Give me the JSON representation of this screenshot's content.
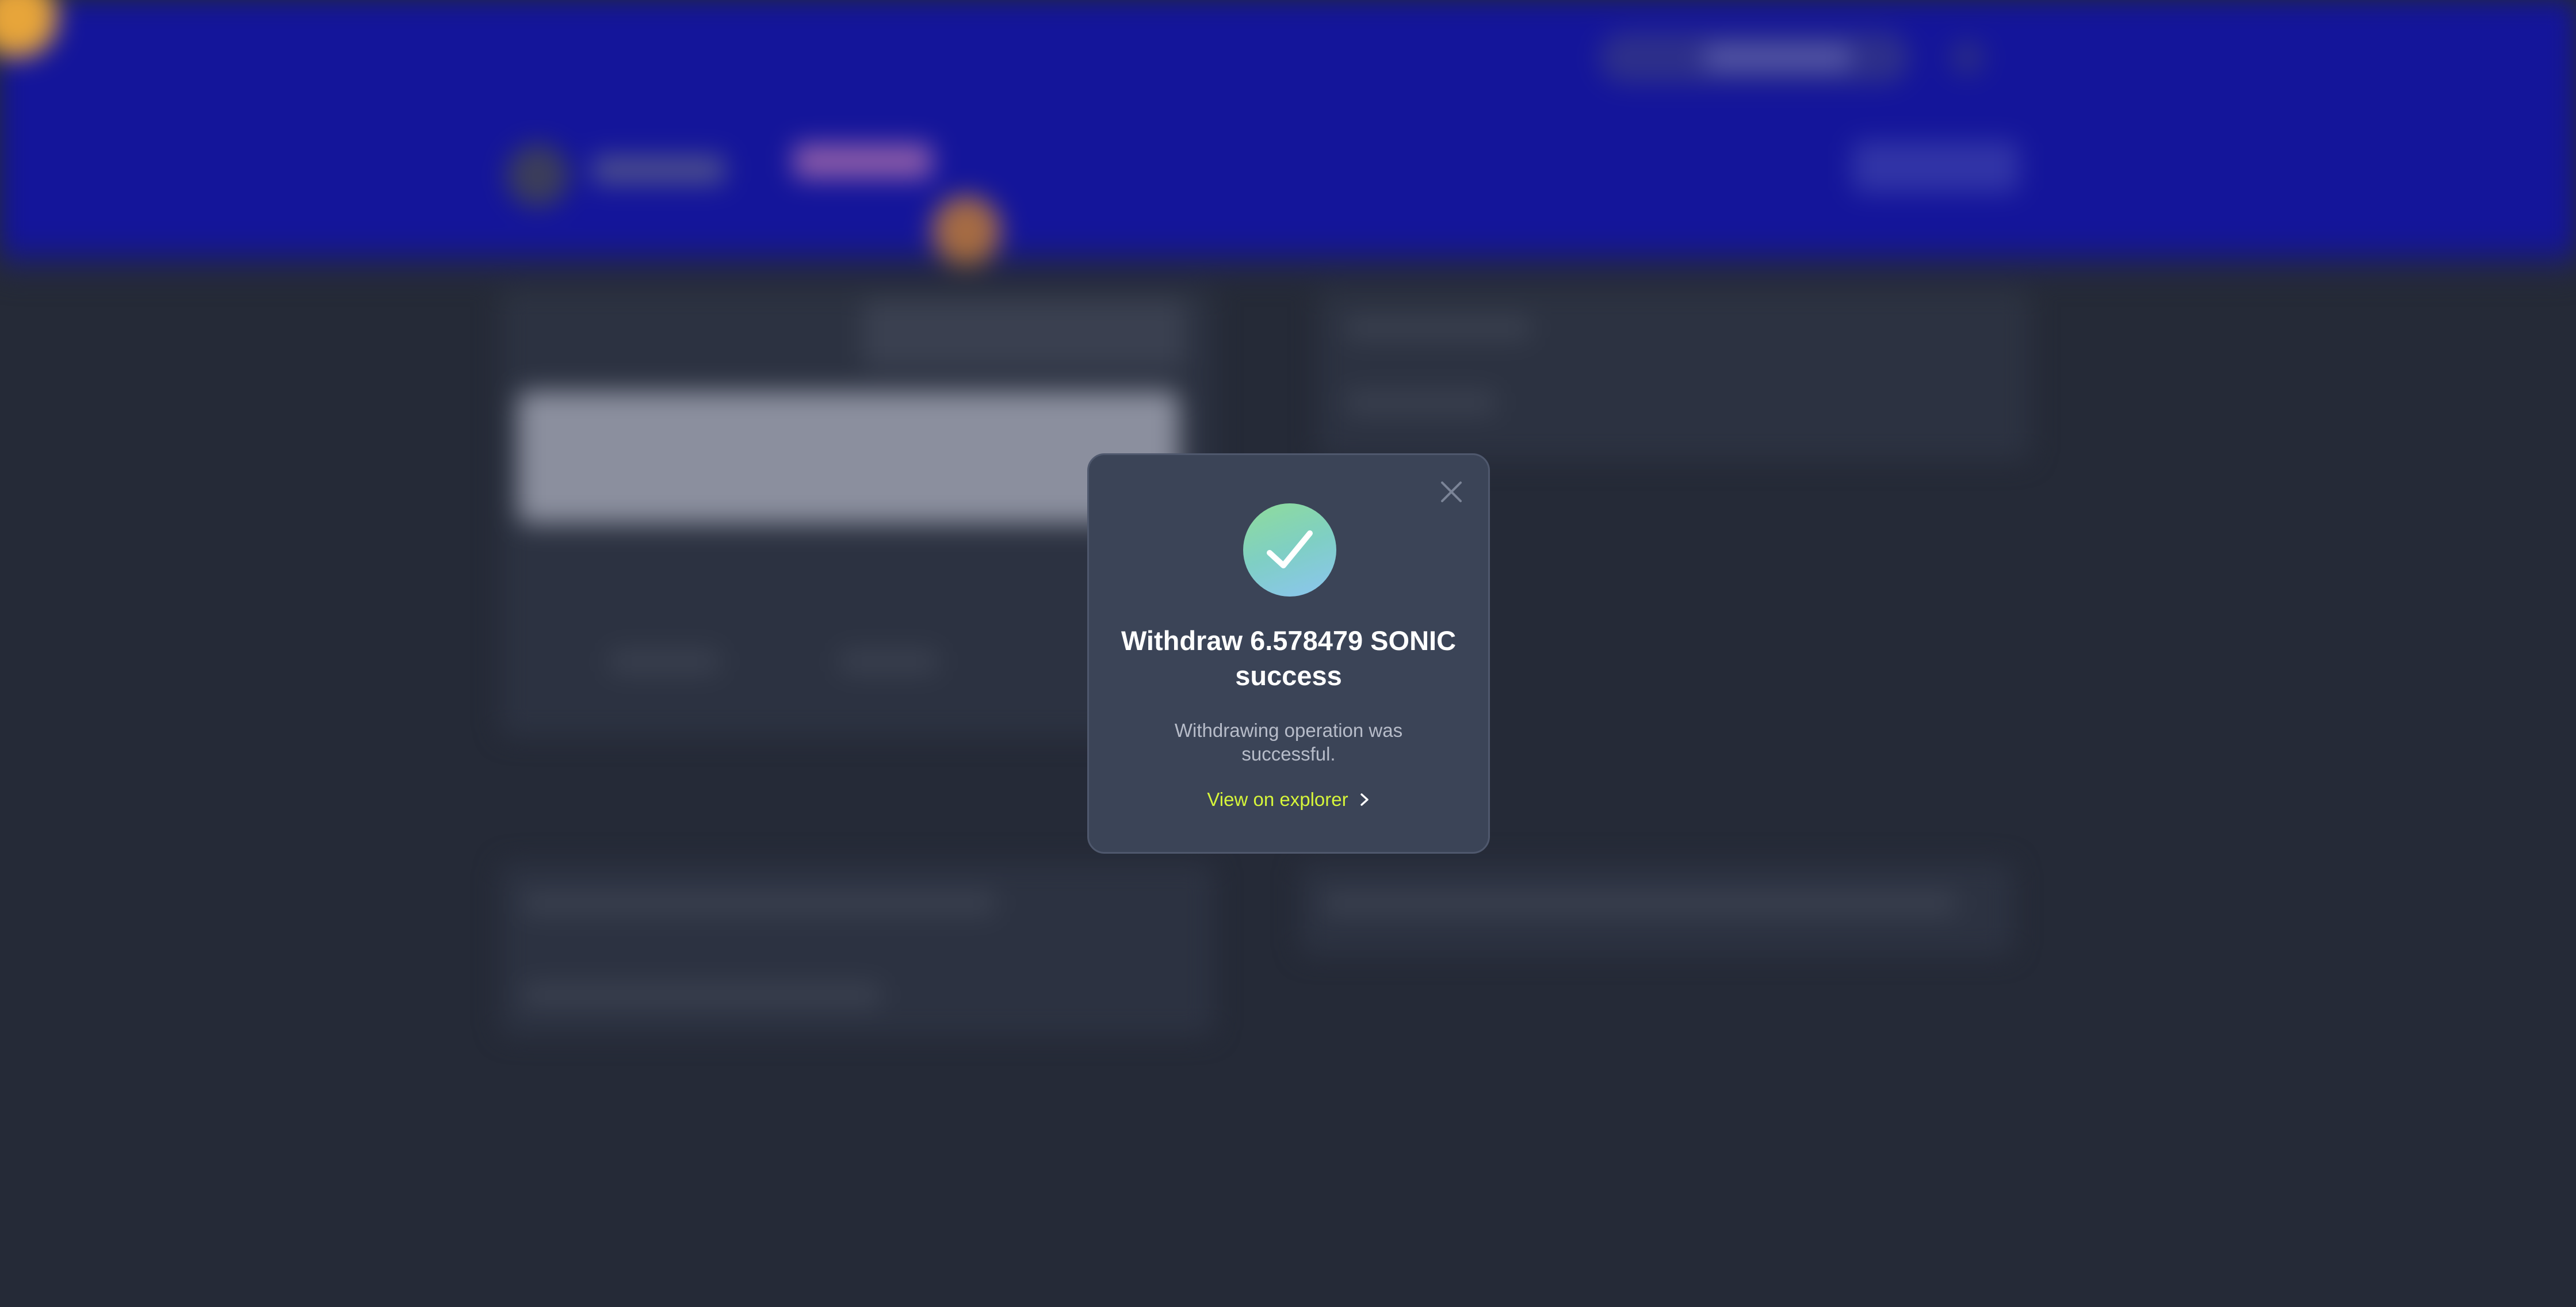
{
  "dialog": {
    "title": "Withdraw 6.578479 SONIC success",
    "description": "Withdrawing operation was successful.",
    "link_label": "View on explorer",
    "close_icon": "close-icon",
    "status_icon": "check-icon",
    "link_icon": "chevron-right-icon"
  },
  "colors": {
    "header_bg": "#14159a",
    "page_bg": "#252a37",
    "dialog_bg": "#3b4457",
    "link": "#d6f53a",
    "success_gradient_start": "#8fdc9a",
    "success_gradient_end": "#8cc5f1"
  }
}
